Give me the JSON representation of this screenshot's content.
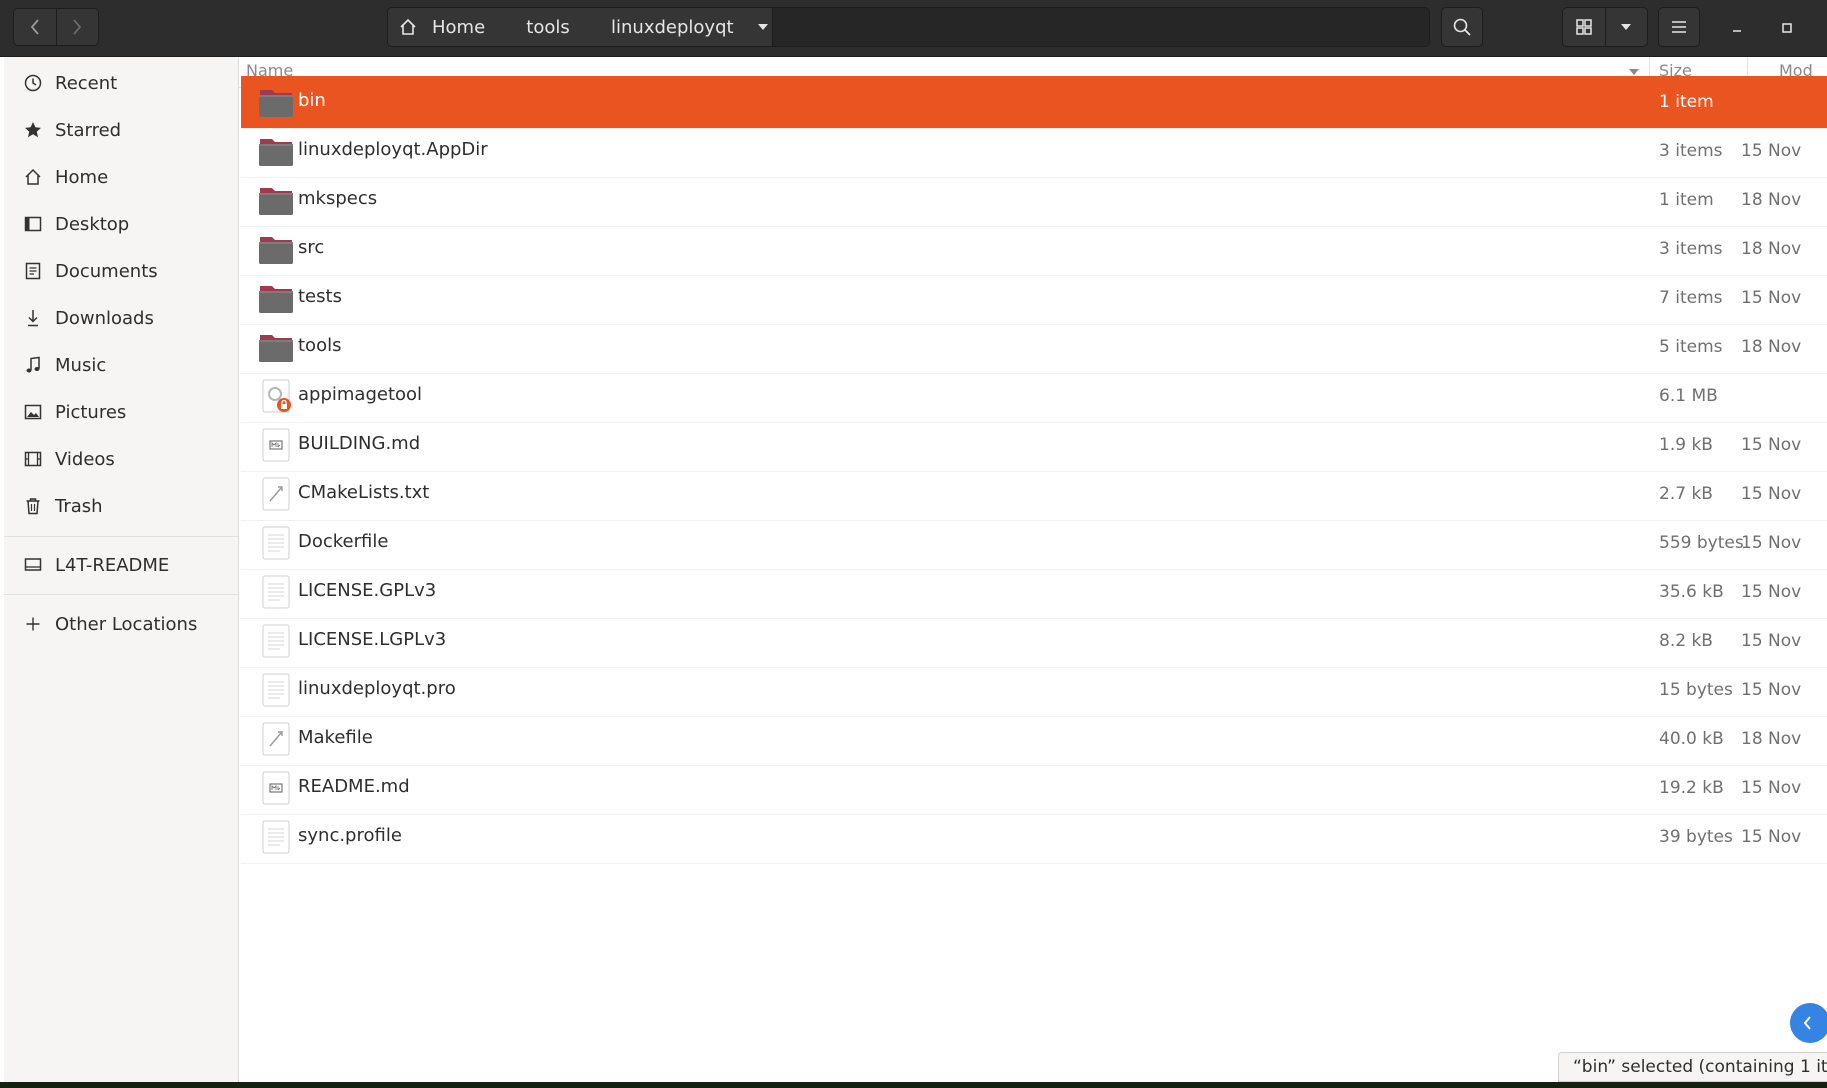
{
  "breadcrumbs": [
    {
      "label": "Home",
      "icon": "home-icon"
    },
    {
      "label": "tools"
    },
    {
      "label": "linuxdeployqt"
    }
  ],
  "sidebar": {
    "places": [
      {
        "label": "Recent",
        "icon": "clock-icon"
      },
      {
        "label": "Starred",
        "icon": "star-icon"
      },
      {
        "label": "Home",
        "icon": "home-icon"
      },
      {
        "label": "Desktop",
        "icon": "desktop-icon"
      },
      {
        "label": "Documents",
        "icon": "document-icon"
      },
      {
        "label": "Downloads",
        "icon": "download-icon"
      },
      {
        "label": "Music",
        "icon": "music-icon"
      },
      {
        "label": "Pictures",
        "icon": "picture-icon"
      },
      {
        "label": "Videos",
        "icon": "video-icon"
      },
      {
        "label": "Trash",
        "icon": "trash-icon"
      }
    ],
    "devices": [
      {
        "label": "L4T-README",
        "icon": "drive-icon"
      }
    ],
    "other": {
      "label": "Other Locations",
      "icon": "plus-icon"
    }
  },
  "columns": {
    "name": "Name",
    "size": "Size",
    "modified": "Mod"
  },
  "files": [
    {
      "name": "bin",
      "type": "folder",
      "size": "1 item",
      "modified": "",
      "selected": true
    },
    {
      "name": "linuxdeployqt.AppDir",
      "type": "folder",
      "size": "3 items",
      "modified": "15 Nov"
    },
    {
      "name": "mkspecs",
      "type": "folder",
      "size": "1 item",
      "modified": "18 Nov"
    },
    {
      "name": "src",
      "type": "folder",
      "size": "3 items",
      "modified": "18 Nov"
    },
    {
      "name": "tests",
      "type": "folder",
      "size": "7 items",
      "modified": "15 Nov"
    },
    {
      "name": "tools",
      "type": "folder",
      "size": "5 items",
      "modified": "18 Nov"
    },
    {
      "name": "appimagetool",
      "type": "executable",
      "size": "6.1 MB",
      "modified": ""
    },
    {
      "name": "BUILDING.md",
      "type": "markdown",
      "size": "1.9 kB",
      "modified": "15 Nov"
    },
    {
      "name": "CMakeLists.txt",
      "type": "script",
      "size": "2.7 kB",
      "modified": "15 Nov"
    },
    {
      "name": "Dockerfile",
      "type": "text",
      "size": "559 bytes",
      "modified": "15 Nov"
    },
    {
      "name": "LICENSE.GPLv3",
      "type": "text",
      "size": "35.6 kB",
      "modified": "15 Nov"
    },
    {
      "name": "LICENSE.LGPLv3",
      "type": "text",
      "size": "8.2 kB",
      "modified": "15 Nov"
    },
    {
      "name": "linuxdeployqt.pro",
      "type": "text",
      "size": "15 bytes",
      "modified": "15 Nov"
    },
    {
      "name": "Makefile",
      "type": "script",
      "size": "40.0 kB",
      "modified": "18 Nov"
    },
    {
      "name": "README.md",
      "type": "markdown",
      "size": "19.2 kB",
      "modified": "15 Nov"
    },
    {
      "name": "sync.profile",
      "type": "text",
      "size": "39 bytes",
      "modified": "15 Nov"
    }
  ],
  "status": "“bin” selected  (containing 1 it",
  "colors": {
    "selection": "#e95420",
    "folder": "#6b6b6b",
    "folder_tab": "#a03a50",
    "headerbar": "#2d2d2d"
  }
}
